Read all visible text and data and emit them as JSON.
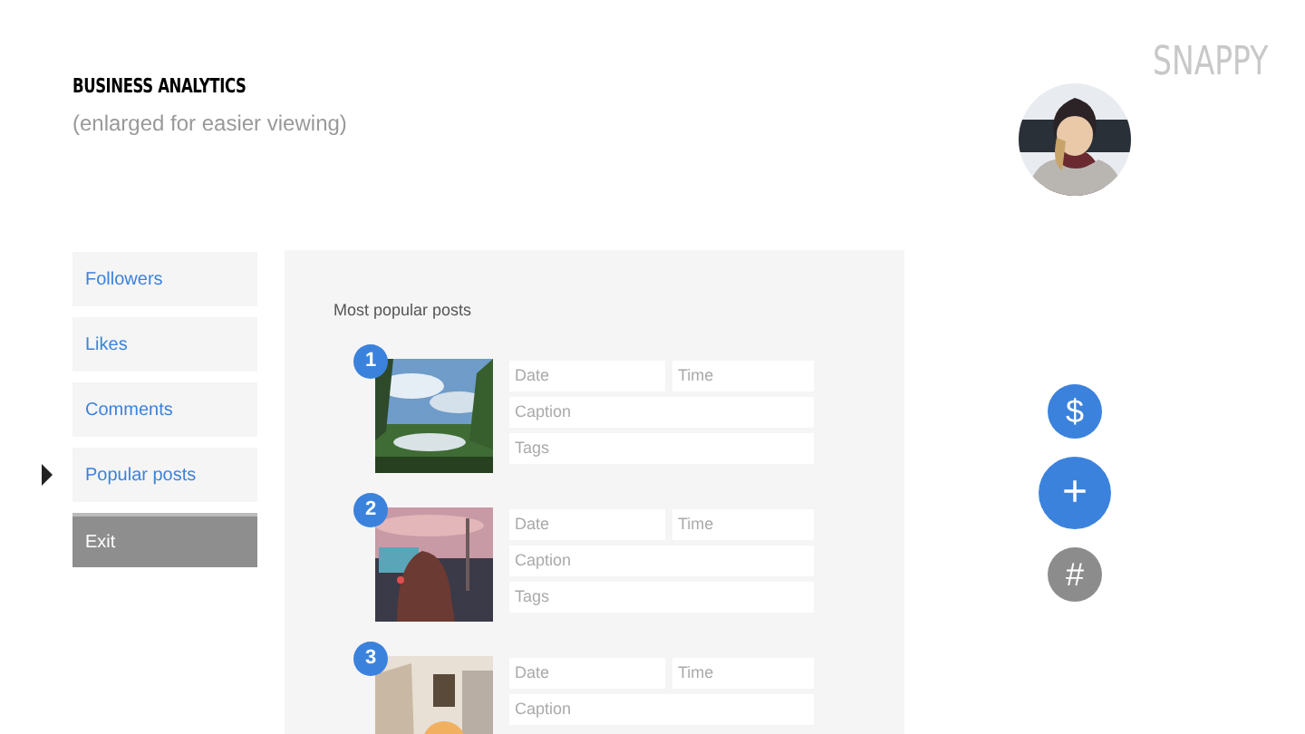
{
  "header": {
    "title": "BUSINESS ANALYTICS",
    "subtitle": "(enlarged for easier viewing)",
    "logo": "SNAPPY"
  },
  "sidebar": {
    "items": [
      {
        "label": "Followers",
        "kind": "link",
        "selected": false
      },
      {
        "label": "Likes",
        "kind": "link",
        "selected": false
      },
      {
        "label": "Comments",
        "kind": "link",
        "selected": false
      },
      {
        "label": "Popular posts",
        "kind": "link",
        "selected": true
      },
      {
        "label": "Exit",
        "kind": "exit",
        "selected": false
      }
    ]
  },
  "panel": {
    "title": "Most popular posts",
    "posts": [
      {
        "number": "1",
        "date_placeholder": "Date",
        "time_placeholder": "Time",
        "caption_placeholder": "Caption",
        "tags_placeholder": "Tags"
      },
      {
        "number": "2",
        "date_placeholder": "Date",
        "time_placeholder": "Time",
        "caption_placeholder": "Caption",
        "tags_placeholder": "Tags"
      },
      {
        "number": "3",
        "date_placeholder": "Date",
        "time_placeholder": "Time",
        "caption_placeholder": "Caption"
      }
    ]
  },
  "actions": [
    {
      "label": "$",
      "kind": "small",
      "color": "#3b82dd"
    },
    {
      "label": "+",
      "kind": "large",
      "color": "#3b82dd"
    },
    {
      "label": "#",
      "kind": "small",
      "color": "#8c8c8c"
    }
  ]
}
